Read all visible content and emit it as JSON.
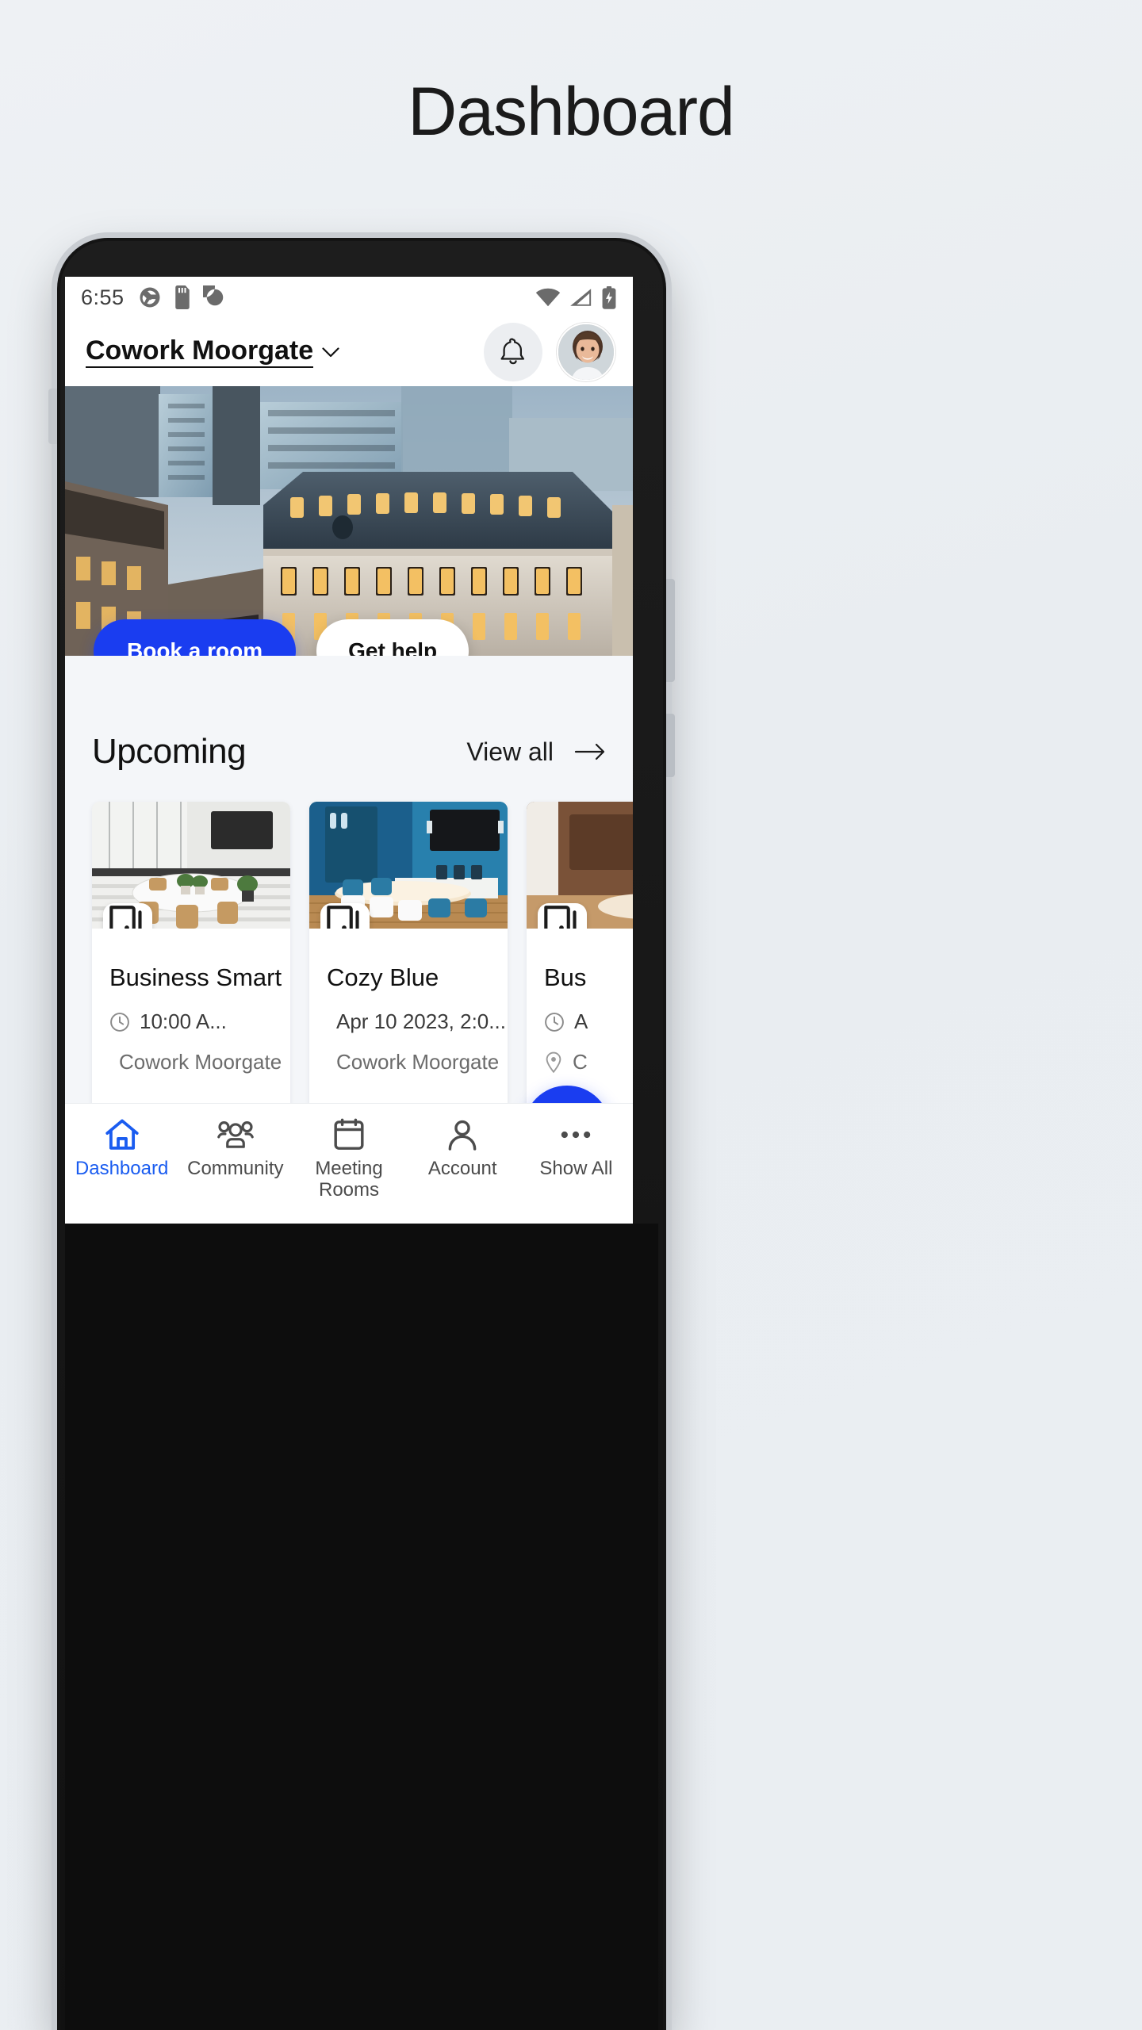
{
  "page": {
    "title": "Dashboard"
  },
  "status_bar": {
    "time": "6:55",
    "left_icons": [
      "camera-shutter-icon",
      "sd-card-icon",
      "circle-slash-icon"
    ],
    "right_icons": [
      "wifi-icon",
      "cellular-signal-icon",
      "battery-charging-icon"
    ]
  },
  "app_bar": {
    "location_name": "Cowork Moorgate",
    "chevron": "chevron-down-icon",
    "notifications": "bell-icon",
    "avatar": "user-avatar"
  },
  "hero": {
    "primary_button": "Book a room",
    "secondary_button": "Get help",
    "image_alt": "city-buildings-aerial"
  },
  "upcoming": {
    "title": "Upcoming",
    "view_all": "View all",
    "arrow": "arrow-right-icon",
    "cards": [
      {
        "name": "Business Smart",
        "time": "10:00 A...",
        "location": "Cowork Moorgate",
        "badge": "door-icon"
      },
      {
        "name": "Cozy Blue",
        "time": "Apr 10 2023, 2:0...",
        "location": "Cowork Moorgate",
        "badge": "door-icon"
      },
      {
        "name": "Bus",
        "time": "A",
        "location": "C",
        "badge": "door-icon"
      }
    ]
  },
  "fab": {
    "icon": "key-icon"
  },
  "bottom_nav": {
    "items": [
      {
        "label": "Dashboard",
        "icon": "home-icon",
        "active": true
      },
      {
        "label": "Community",
        "icon": "people-icon",
        "active": false
      },
      {
        "label": "Meeting Rooms",
        "icon": "calendar-icon",
        "active": false
      },
      {
        "label": "Account",
        "icon": "person-icon",
        "active": false
      },
      {
        "label": "Show All",
        "icon": "ellipsis-icon",
        "active": false
      }
    ]
  },
  "colors": {
    "accent": "#1a3df0",
    "nav_active": "#1a5cf0",
    "page_bg": "#eef1f4",
    "content_bg": "#f4f6f9"
  }
}
